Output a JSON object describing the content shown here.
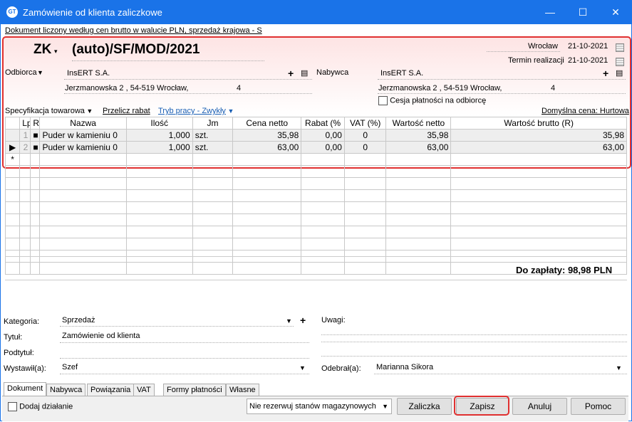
{
  "window": {
    "title": "Zamówienie od klienta zaliczkowe",
    "icon_text": "GT",
    "min": "—",
    "max": "☐",
    "close": "✕"
  },
  "doc_info": "Dokument liczony według cen brutto w walucie PLN, sprzedaż krajowa - S",
  "header": {
    "doc_type": "ZK",
    "doc_number": "(auto)/SF/MOD/2021",
    "place_label": "Wrocław",
    "date1": "21-10-2021",
    "termin_label": "Termin realizacji",
    "date2": "21-10-2021"
  },
  "odbiorca": {
    "label": "Odbiorca",
    "name": "InsERT S.A.",
    "address": "Jerzmanowska 2 , 54-519 Wrocław,",
    "mark": "4"
  },
  "nabywca": {
    "label": "Nabywca",
    "name": "InsERT S.A.",
    "address": "Jerzmanowska 2 , 54-519 Wrocław,",
    "mark": "4"
  },
  "cesja_label": "Cesja płatności na odbiorcę",
  "toolbar": {
    "spec": "Specyfikacja towarowa",
    "przelicz": "Przelicz rabat",
    "tryb": "Tryb pracy - Zwykły",
    "domyslna": "Domyślna cena: Hurtowa"
  },
  "table": {
    "headers": [
      "Lp",
      "R",
      "Nazwa",
      "Ilość",
      "Jm",
      "Cena netto",
      "Rabat (%",
      "VAT (%)",
      "Wartość netto",
      "Wartość brutto (R)"
    ],
    "rows": [
      {
        "lp": "1",
        "name": "Puder w kamieniu 0",
        "qty": "1,000",
        "jm": "szt.",
        "cena": "35,98",
        "rabat": "0,00",
        "vat": "0",
        "netto": "35,98",
        "brutto": "35,98"
      },
      {
        "lp": "2",
        "name": "Puder w kamieniu 0",
        "qty": "1,000",
        "jm": "szt.",
        "cena": "63,00",
        "rabat": "0,00",
        "vat": "0",
        "netto": "63,00",
        "brutto": "63,00"
      }
    ],
    "new_row_marker": "*",
    "current_marker": "▶"
  },
  "total": "Do zapłaty: 98,98 PLN",
  "bottom": {
    "kategoria_label": "Kategoria:",
    "kategoria_value": "Sprzedaż",
    "tytul_label": "Tytuł:",
    "tytul_value": "Zamówienie od klienta",
    "podtytul_label": "Podtytuł:",
    "wystawil_label": "Wystawił(a):",
    "wystawil_value": "Szef",
    "uwagi_label": "Uwagi:",
    "odebral_label": "Odebrał(a):",
    "odebral_value": "Marianna Sikora"
  },
  "tabs": [
    "Dokument",
    "Nabywca",
    "Powiązania",
    "VAT",
    "Formy płatności",
    "Własne"
  ],
  "footer": {
    "dodaj": "Dodaj działanie",
    "rezerwacja": "Nie rezerwuj stanów magazynowych",
    "zaliczka": "Zaliczka",
    "zapisz": "Zapisz",
    "anuluj": "Anuluj",
    "pomoc": "Pomoc"
  },
  "colors": {
    "titlebar": "#1a73e8",
    "highlight": "#e03030",
    "link": "#1a5fb4"
  }
}
